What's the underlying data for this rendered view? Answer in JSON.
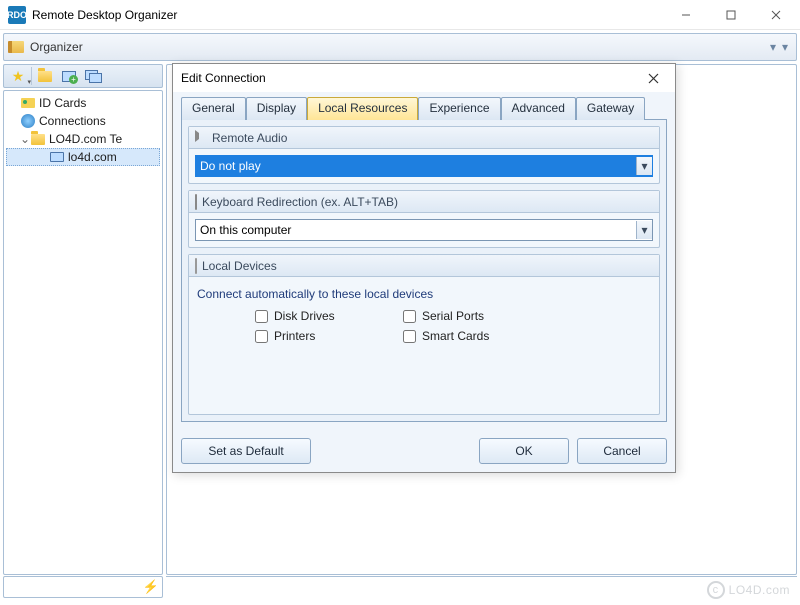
{
  "window": {
    "title": "Remote Desktop Organizer",
    "app_icon_text": "RDO"
  },
  "organizer_bar": {
    "label": "Organizer"
  },
  "tree": {
    "items": [
      {
        "label": "ID Cards",
        "icon": "idcard"
      },
      {
        "label": "Connections",
        "icon": "globe"
      },
      {
        "label": "LO4D.com Te",
        "icon": "folder",
        "expandable": true
      },
      {
        "label": "lo4d.com",
        "icon": "monitor",
        "selected": true
      }
    ]
  },
  "dialog": {
    "title": "Edit Connection",
    "tabs": [
      "General",
      "Display",
      "Local Resources",
      "Experience",
      "Advanced",
      "Gateway"
    ],
    "active_tab": "Local Resources",
    "remote_audio": {
      "header": "Remote Audio",
      "value": "Do not play"
    },
    "keyboard_redirection": {
      "header": "Keyboard Redirection (ex. ALT+TAB)",
      "value": "On this computer"
    },
    "local_devices": {
      "header": "Local Devices",
      "description": "Connect automatically to these local devices",
      "options": [
        "Disk Drives",
        "Serial Ports",
        "Printers",
        "Smart Cards"
      ]
    },
    "buttons": {
      "set_default": "Set as Default",
      "ok": "OK",
      "cancel": "Cancel"
    }
  },
  "watermark": "LO4D.com"
}
